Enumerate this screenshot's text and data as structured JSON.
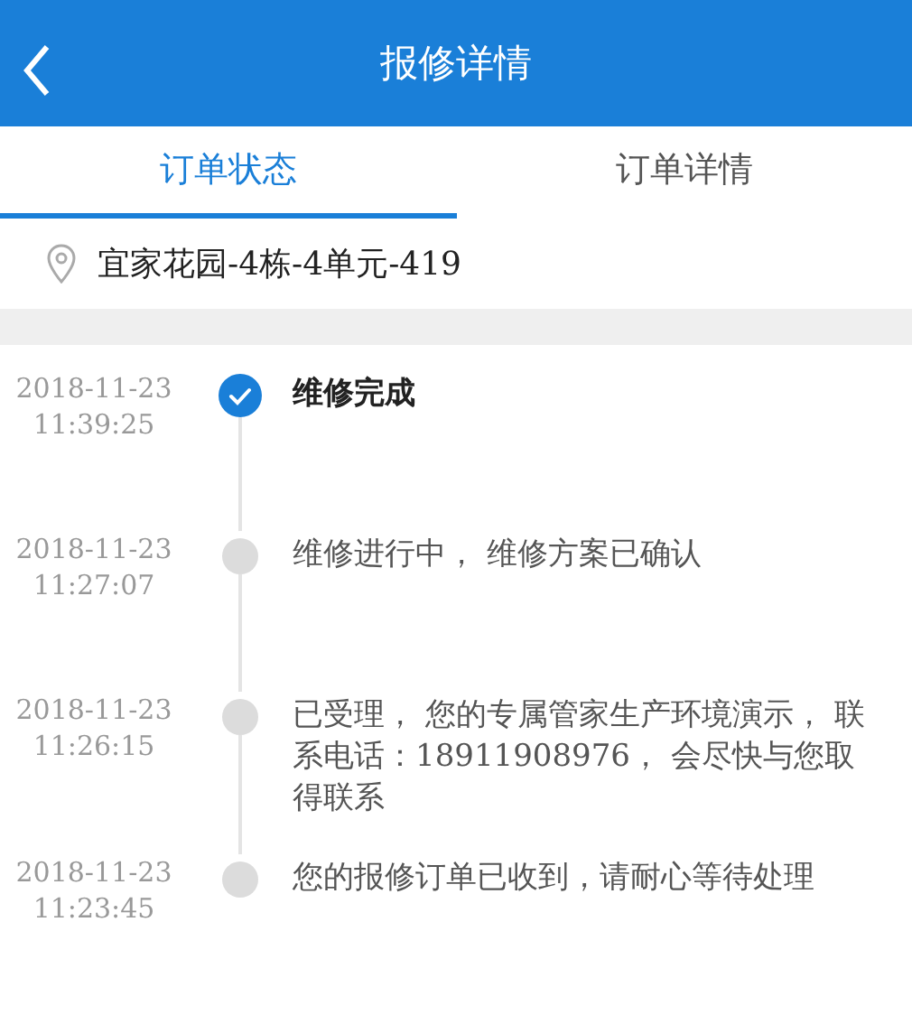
{
  "header": {
    "title": "报修详情"
  },
  "tabs": [
    {
      "label": "订单状态",
      "selected": true
    },
    {
      "label": "订单详情",
      "selected": false
    }
  ],
  "address": "宜家花园-4栋-4单元-419",
  "timeline": [
    {
      "date": "2018-11-23",
      "time": "11:39:25",
      "text": "维修完成",
      "done": true
    },
    {
      "date": "2018-11-23",
      "time": "11:27:07",
      "text": "维修进行中， 维修方案已确认",
      "done": false
    },
    {
      "date": "2018-11-23",
      "time": "11:26:15",
      "text": "已受理， 您的专属管家生产环境演示，  联系电话：18911908976， 会尽快与您取得联系",
      "done": false
    },
    {
      "date": "2018-11-23",
      "time": "11:23:45",
      "text": "您的报修订单已收到，请耐心等待处理",
      "done": false
    }
  ]
}
